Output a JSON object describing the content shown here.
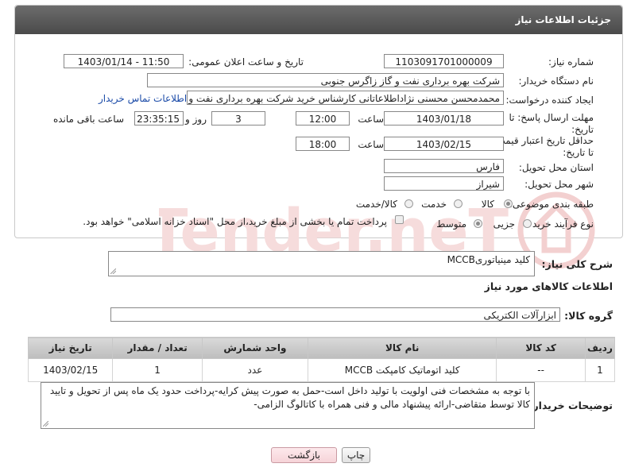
{
  "page": {
    "title": "جزئیات اطلاعات نیاز"
  },
  "form": {
    "need_number_label": "شماره نیاز:",
    "need_number": "1103091701000009",
    "announce_label": "تاریخ و ساعت اعلان عمومی:",
    "announce_value": "1403/01/14 - 11:50",
    "buyer_org_label": "نام دستگاه خریدار:",
    "buyer_org": "شرکت بهره برداری نفت و گاز زاگرس جنوبی",
    "requester_label": "ایجاد کننده درخواست:",
    "requester": "محمدمحسن محسنی نژاداطلاعاتانی کارشناس خرید شرکت بهره برداری نفت و",
    "buyer_contact_link": "اطلاعات تماس خریدار",
    "reply_deadline_label": "مهلت ارسال پاسخ: تا تاریخ:",
    "reply_date": "1403/01/18",
    "time_label": "ساعت",
    "reply_time": "12:00",
    "days_value": "3",
    "days_label": "روز و",
    "remaining_time": "23:35:15",
    "remaining_label": "ساعت باقی مانده",
    "price_valid_label": "حداقل تاریخ اعتبار قیمت: تا تاریخ:",
    "price_valid_date": "1403/02/15",
    "price_valid_time": "18:00",
    "province_label": "استان محل تحویل:",
    "province": "فارس",
    "city_label": "شهر محل تحویل:",
    "city": "شیراز",
    "category_label": "طبقه بندی موضوعی:",
    "category_options": [
      "کالا",
      "خدمت",
      "کالا/خدمت"
    ],
    "category_selected": "کالا",
    "process_label": "نوع فرآیند خرید :",
    "process_options": [
      "جزیی",
      "متوسط"
    ],
    "payment_note": "پرداخت تمام یا بخشی از مبلغ خرید،از محل \"اسناد خزانه اسلامی\" خواهد بود."
  },
  "description": {
    "label": "شرح کلی نیاز:",
    "value": "کلید مینیاتوریMCCB"
  },
  "goods": {
    "section_title": "اطلاعات کالاهای مورد نیاز",
    "group_label": "گروه کالا:",
    "group_value": "ابزارآلات الکتریکی",
    "columns": [
      "ردیف",
      "کد کالا",
      "نام کالا",
      "واحد شمارش",
      "تعداد / مقدار",
      "تاریخ نیاز"
    ],
    "rows": [
      [
        "1",
        "--",
        "کلید اتوماتیک کامپکت MCCB",
        "عدد",
        "1",
        "1403/02/15"
      ]
    ]
  },
  "buyer_notes": {
    "label": "توضیحات خریدار:",
    "value": "با توجه به مشخصات فنی اولویت با تولید داخل است-حمل به صورت پیش کرایه-پرداخت حدود یک ماه پس از تحویل و تایید کالا توسط متقاضی-ارائه پیشنهاد مالی و فنی همراه با کاتالوگ الزامی-"
  },
  "buttons": {
    "print": "چاپ",
    "back": "بازگشت"
  },
  "watermark": {
    "text": "AriaTender.neT"
  },
  "colors": {
    "header_bg": "#555555",
    "link": "#1b4ba8",
    "watermark": "#f1c8c8"
  }
}
